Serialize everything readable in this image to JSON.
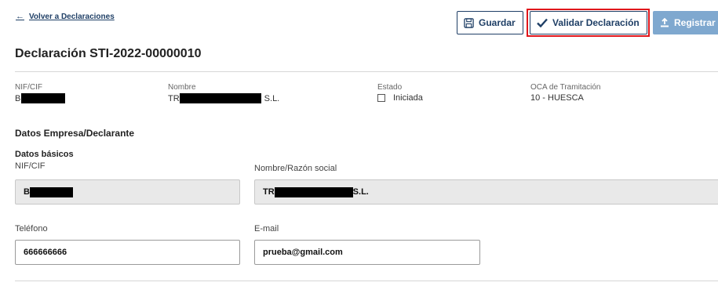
{
  "nav": {
    "back_arrow": "←",
    "back_label": "Volver a Declaraciones"
  },
  "toolbar": {
    "guardar_label": "Guardar",
    "validar_label": "Validar Declaración",
    "registrar_label": "Registrar"
  },
  "page": {
    "title": "Declaración STI-2022-00000010"
  },
  "summary": {
    "nif_label": "NIF/CIF",
    "nif_value": "B",
    "nombre_label": "Nombre",
    "nombre_prefix": "TR",
    "nombre_suffix": "S.L.",
    "estado_label": "Estado",
    "estado_value": "Iniciada",
    "oca_label": "OCA de Tramitación",
    "oca_value": "10 - HUESCA"
  },
  "section": {
    "title": "Datos Empresa/Declarante",
    "subtitle": "Datos básicos",
    "nif_label": "NIF/CIF",
    "nif_value": "B",
    "razon_label": "Nombre/Razón social",
    "razon_prefix": "TR",
    "razon_suffix": "S.L.",
    "telefono_label": "Teléfono",
    "telefono_value": "666666666",
    "email_label": "E-mail",
    "email_value": "prueba@gmail.com"
  },
  "colors": {
    "primary": "#1f3f66",
    "highlight": "#e0161b",
    "disabled": "#7fa8cf"
  }
}
